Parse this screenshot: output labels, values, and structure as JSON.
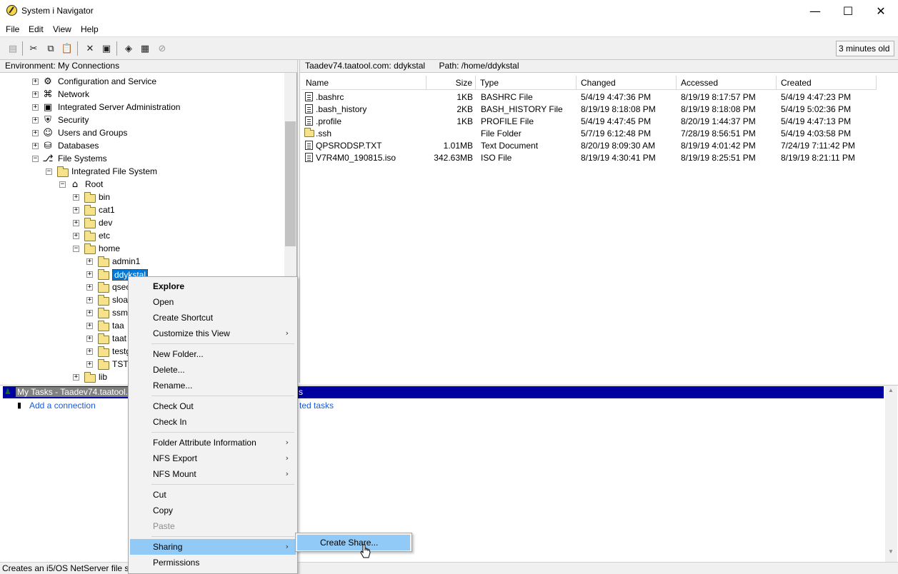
{
  "window": {
    "title": "System i Navigator",
    "minimize_glyph": "—",
    "maximize_glyph": "☐",
    "close_glyph": "✕"
  },
  "menubar": {
    "items": [
      {
        "label": "File"
      },
      {
        "label": "Edit"
      },
      {
        "label": "View"
      },
      {
        "label": "Help"
      }
    ]
  },
  "toolbar": {
    "icons": [
      "properties-icon",
      "cut-icon",
      "copy-icon",
      "paste-icon",
      "delete-icon",
      "properties2-icon",
      "connect-icon",
      "schedule-icon",
      "stop-icon"
    ],
    "status_age": "3 minutes old"
  },
  "left_pane": {
    "header": "Environment: My Connections",
    "tree": [
      {
        "label": "Configuration and Service",
        "expander": "+",
        "icon": "config-icon",
        "level": 0
      },
      {
        "label": "Network",
        "expander": "+",
        "icon": "network-icon",
        "level": 0
      },
      {
        "label": "Integrated Server Administration",
        "expander": "+",
        "icon": "server-icon",
        "level": 0
      },
      {
        "label": "Security",
        "expander": "+",
        "icon": "security-icon",
        "level": 0
      },
      {
        "label": "Users and Groups",
        "expander": "+",
        "icon": "users-icon",
        "level": 0
      },
      {
        "label": "Databases",
        "expander": "+",
        "icon": "database-icon",
        "level": 0
      },
      {
        "label": "File Systems",
        "expander": "−",
        "icon": "filesystems-icon",
        "level": 0
      },
      {
        "label": "Integrated File System",
        "expander": "−",
        "icon": "folder-icon",
        "level": 1
      },
      {
        "label": "Root",
        "expander": "−",
        "icon": "root-icon",
        "level": 2
      },
      {
        "label": "bin",
        "expander": "+",
        "icon": "folder-icon",
        "level": 3
      },
      {
        "label": "cat1",
        "expander": "+",
        "icon": "folder-icon",
        "level": 3
      },
      {
        "label": "dev",
        "expander": "+",
        "icon": "folder-icon",
        "level": 3
      },
      {
        "label": "etc",
        "expander": "+",
        "icon": "folder-icon",
        "level": 3
      },
      {
        "label": "home",
        "expander": "−",
        "icon": "folder-icon",
        "level": 3
      },
      {
        "label": "admin1",
        "expander": "+",
        "icon": "folder-icon",
        "level": 4
      },
      {
        "label": "ddykstal",
        "expander": "+",
        "icon": "folder-icon",
        "level": 4,
        "selected": true
      },
      {
        "label": "qsec",
        "expander": "+",
        "icon": "folder-icon",
        "level": 4
      },
      {
        "label": "sloa",
        "expander": "+",
        "icon": "folder-icon",
        "level": 4
      },
      {
        "label": "ssm",
        "expander": "+",
        "icon": "folder-icon",
        "level": 4
      },
      {
        "label": "taa",
        "expander": "+",
        "icon": "folder-icon",
        "level": 4
      },
      {
        "label": "taat",
        "expander": "+",
        "icon": "folder-icon",
        "level": 4
      },
      {
        "label": "testg",
        "expander": "+",
        "icon": "folder-icon",
        "level": 4
      },
      {
        "label": "TSTI",
        "expander": "+",
        "icon": "folder-icon",
        "level": 4
      },
      {
        "label": "lib",
        "expander": "+",
        "icon": "folder-icon",
        "level": 3
      }
    ]
  },
  "right_pane": {
    "header_system": "Taadev74.taatool.com:  ddykstal",
    "header_path": "Path:  /home/ddykstal",
    "columns": [
      "Name",
      "Size",
      "Type",
      "Changed",
      "Accessed",
      "Created"
    ],
    "rows": [
      {
        "name": ".bashrc",
        "size": "1KB",
        "type": "BASHRC File",
        "changed": "5/4/19 4:47:36 PM",
        "accessed": "8/19/19 8:17:57 PM",
        "created": "5/4/19 4:47:23 PM",
        "icon": "file-icon"
      },
      {
        "name": ".bash_history",
        "size": "2KB",
        "type": "BASH_HISTORY File",
        "changed": "8/19/19 8:18:08 PM",
        "accessed": "8/19/19 8:18:08 PM",
        "created": "5/4/19 5:02:36 PM",
        "icon": "file-icon"
      },
      {
        "name": ".profile",
        "size": "1KB",
        "type": "PROFILE File",
        "changed": "5/4/19 4:47:45 PM",
        "accessed": "8/20/19 1:44:37 PM",
        "created": "5/4/19 4:47:13 PM",
        "icon": "file-icon"
      },
      {
        "name": ".ssh",
        "size": "",
        "type": "File Folder",
        "changed": "5/7/19 6:12:48 PM",
        "accessed": "7/28/19 8:56:51 PM",
        "created": "5/4/19 4:03:58 PM",
        "icon": "folder-icon"
      },
      {
        "name": "QPSRODSP.TXT",
        "size": "1.01MB",
        "type": "Text Document",
        "changed": "8/20/19 8:09:30 AM",
        "accessed": "8/19/19 4:01:42 PM",
        "created": "7/24/19 7:11:42 PM",
        "icon": "file-icon"
      },
      {
        "name": "V7R4M0_190815.iso",
        "size": "342.63MB",
        "type": "ISO File",
        "changed": "8/19/19 4:30:41 PM",
        "accessed": "8/19/19 8:25:51 PM",
        "created": "8/19/19 8:21:11 PM",
        "icon": "file-icon"
      }
    ]
  },
  "tasks": {
    "title": "My Tasks - Taadev74.taatool.c",
    "right_text": "s",
    "add_connection": "Add a connection",
    "right_link": "ted tasks"
  },
  "statusbar": {
    "text": "Creates an i5/OS NetServer file sh"
  },
  "context_menu": {
    "items": [
      {
        "label": "Explore",
        "bold": true
      },
      {
        "label": "Open"
      },
      {
        "label": "Create Shortcut"
      },
      {
        "label": "Customize this View",
        "submenu": true
      },
      {
        "separator": true
      },
      {
        "label": "New Folder..."
      },
      {
        "label": "Delete..."
      },
      {
        "label": "Rename..."
      },
      {
        "separator": true
      },
      {
        "label": "Check Out"
      },
      {
        "label": "Check In"
      },
      {
        "separator": true
      },
      {
        "label": "Folder Attribute Information",
        "submenu": true
      },
      {
        "label": "NFS Export",
        "submenu": true
      },
      {
        "label": "NFS Mount",
        "submenu": true
      },
      {
        "separator": true
      },
      {
        "label": "Cut"
      },
      {
        "label": "Copy"
      },
      {
        "label": "Paste",
        "disabled": true
      },
      {
        "separator": true
      },
      {
        "label": "Sharing",
        "submenu": true,
        "highlight": true
      },
      {
        "label": "Permissions"
      }
    ],
    "submenu_arrow": "›"
  },
  "submenu": {
    "create_share": "Create Share..."
  }
}
